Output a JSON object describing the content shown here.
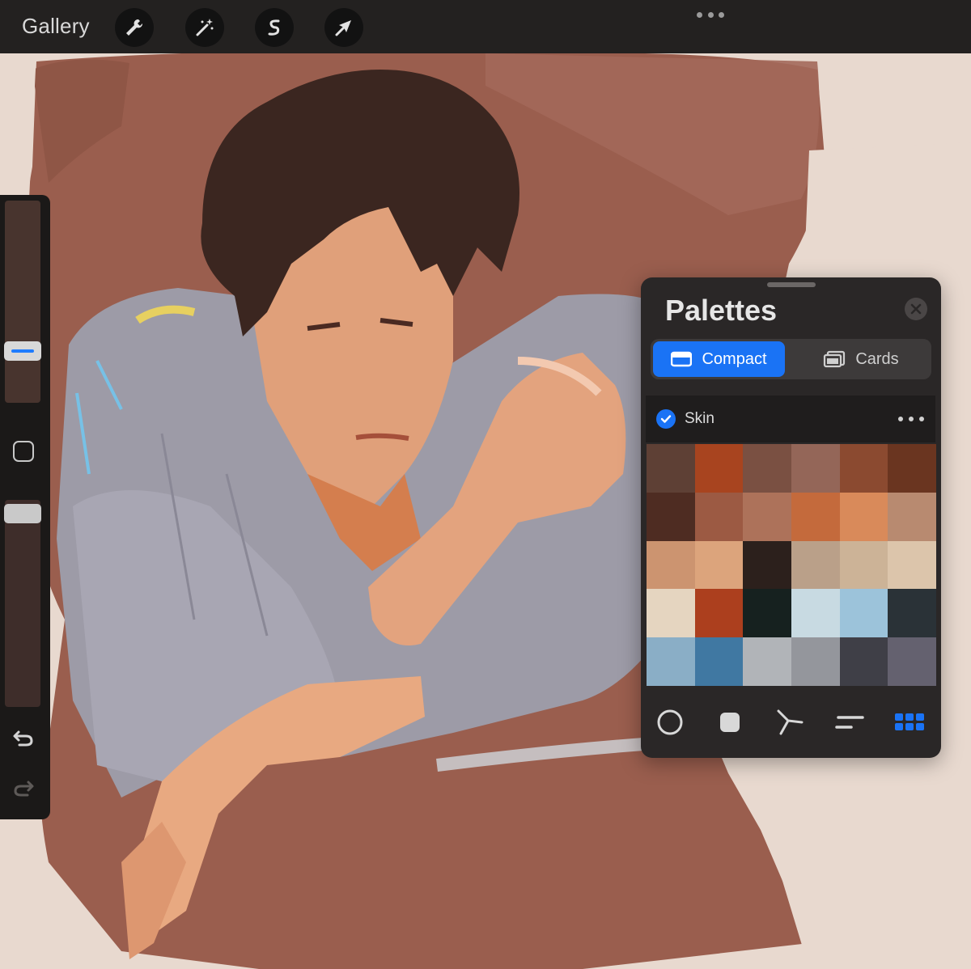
{
  "app": {
    "topbar": {
      "gallery_label": "Gallery",
      "tools": [
        {
          "icon": "wrench-icon",
          "name": "actions"
        },
        {
          "icon": "magic-wand-icon",
          "name": "adjustments"
        },
        {
          "icon": "selection-s-icon",
          "name": "selection"
        },
        {
          "icon": "arrow-cursor-icon",
          "name": "transform"
        }
      ],
      "more_icon": "ellipsis-icon"
    },
    "sidebar": {
      "brush_size_level": 0.72,
      "brush_opacity_level": 0.98,
      "undo_icon": "undo-icon",
      "redo_icon": "redo-icon"
    },
    "palettes": {
      "title": "Palettes",
      "tabs": [
        {
          "label": "Compact",
          "icon": "compact-view-icon",
          "selected": true
        },
        {
          "label": "Cards",
          "icon": "cards-view-icon",
          "selected": false
        }
      ],
      "palette_name": "Skin",
      "palette_default": true,
      "swatches": [
        "#5e4035",
        "#a8441f",
        "#7a5042",
        "#946658",
        "#8b4a30",
        "#6a3520",
        "#4e2c22",
        "#9c5a43",
        "#ad725a",
        "#c46a3c",
        "#d98a5a",
        "#b88a70",
        "#cc9470",
        "#dca47c",
        "#2c201c",
        "#baa089",
        "#ccb397",
        "#dcc5ab",
        "#e5d5c0",
        "#ac3f1e",
        "#16211f",
        "#c8dae2",
        "#9cc3da",
        "#2a3237",
        "#8aaec6",
        "#4078a2",
        "#b1b4b8",
        "#94969c",
        "#3f3f47",
        "#64616f"
      ],
      "color_modes": [
        {
          "name": "disc",
          "icon": "color-disc-icon",
          "active": false
        },
        {
          "name": "classic",
          "icon": "classic-square-icon",
          "active": false
        },
        {
          "name": "harmony",
          "icon": "harmony-icon",
          "active": false
        },
        {
          "name": "value",
          "icon": "value-sliders-icon",
          "active": false
        },
        {
          "name": "palettes",
          "icon": "palette-grid-icon",
          "active": true
        }
      ],
      "accent_color": "#1a73f5"
    },
    "canvas": {
      "subject": "painted portrait of a man in a grey-blue shirt",
      "background_color": "#e8d9cf",
      "brush_stroke_color": "#9a5e4e",
      "shirt_color": "#9d9ba7",
      "skin_color": "#e0a07a",
      "hair_color": "#3b2620"
    }
  }
}
